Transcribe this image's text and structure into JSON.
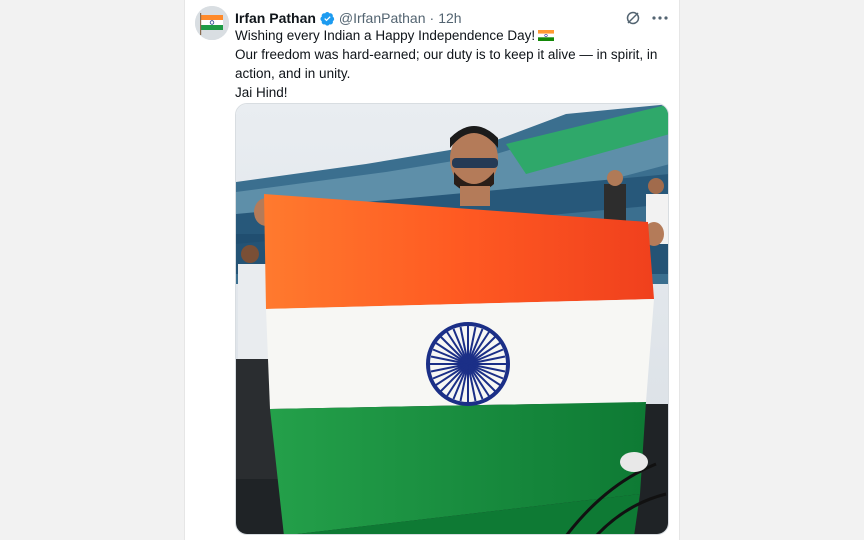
{
  "tweet": {
    "author_name": "Irfan Pathan",
    "handle": "@IrfanPathan",
    "separator": "·",
    "time": "12h",
    "lines": [
      "Wishing every Indian a Happy Independence Day!",
      "Our freedom was hard-earned; our duty is to keep it alive — in spirit, in action, and in unity.",
      "Jai Hind!"
    ],
    "verified_color": "#1d9bf0",
    "icons": [
      "avatar-flag",
      "verified-badge",
      "grok-icon",
      "more-icon",
      "india-flag-emoji"
    ]
  },
  "media": {
    "subject": "photo"
  }
}
